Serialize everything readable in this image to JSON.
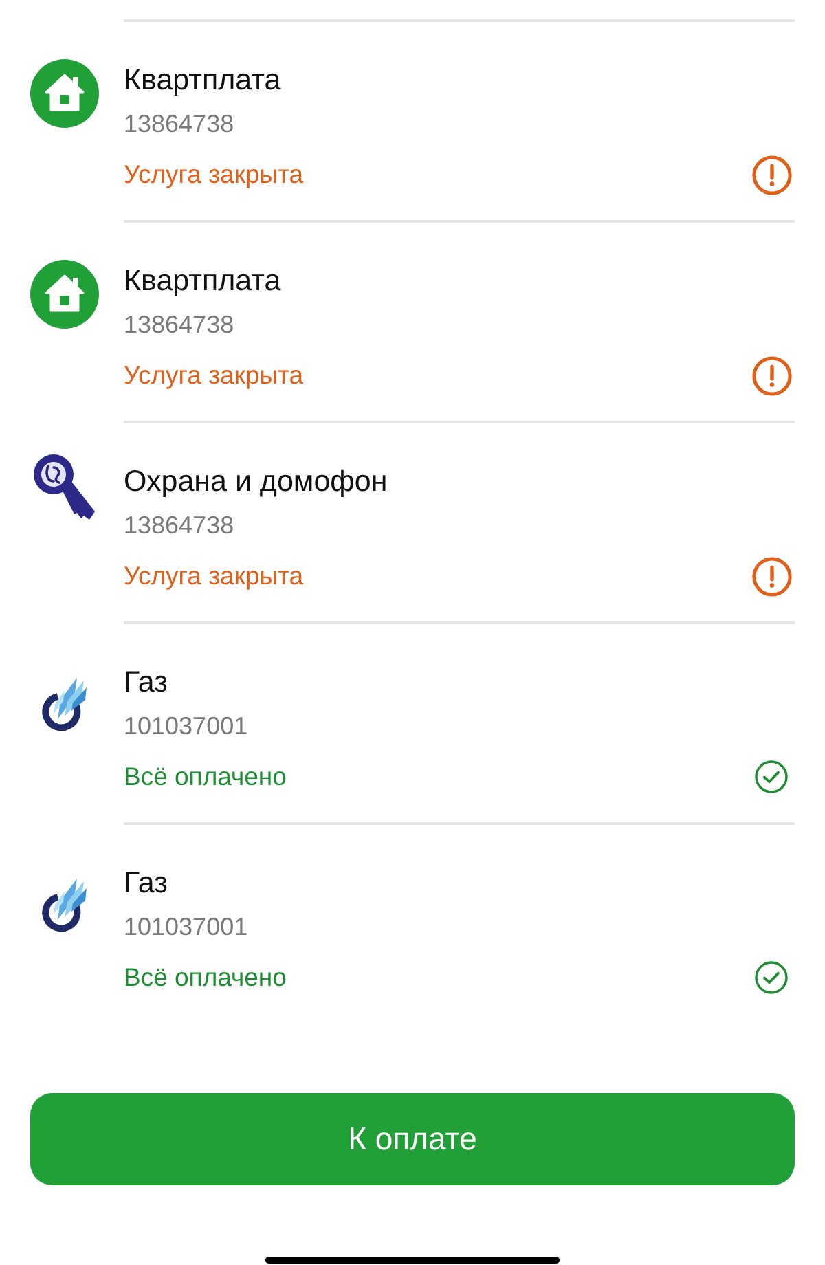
{
  "services": [
    {
      "kind": "house",
      "title": "Квартплата",
      "account": "13864738",
      "status": {
        "kind": "closed",
        "text": "Услуга закрыта"
      }
    },
    {
      "kind": "house",
      "title": "Квартплата",
      "account": "13864738",
      "status": {
        "kind": "closed",
        "text": "Услуга закрыта"
      }
    },
    {
      "kind": "key",
      "title": "Охрана и домофон",
      "account": "13864738",
      "status": {
        "kind": "closed",
        "text": "Услуга закрыта"
      }
    },
    {
      "kind": "gas",
      "title": "Газ",
      "account": "101037001",
      "status": {
        "kind": "paid",
        "text": "Всё оплачено"
      }
    },
    {
      "kind": "gas",
      "title": "Газ",
      "account": "101037001",
      "status": {
        "kind": "paid",
        "text": "Всё оплачено"
      }
    }
  ],
  "pay_button": {
    "label": "К оплате"
  }
}
